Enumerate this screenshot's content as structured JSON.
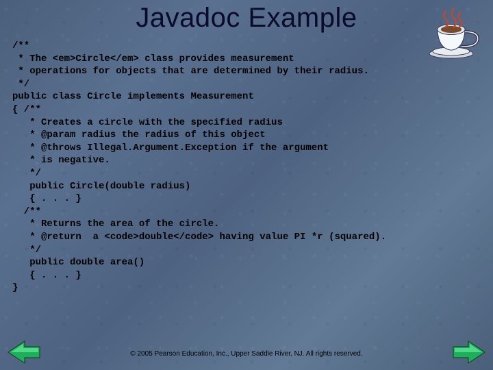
{
  "title": "Javadoc Example",
  "code_lines": [
    "/**",
    " * The <em>Circle</em> class provides measurement",
    " * operations for objects that are determined by their radius.",
    " */",
    "public class Circle implements Measurement",
    "{ /**",
    "   * Creates a circle with the specified radius",
    "   * @param radius the radius of this object",
    "   * @throws Illegal.Argument.Exception if the argument",
    "   * is negative.",
    "   */",
    "   public Circle(double radius)",
    "   { . . . }",
    "  /**",
    "   * Returns the area of the circle.",
    "   * @return  a <code>double</code> having value PI *r (squared).",
    "   */",
    "   public double area()",
    "   { . . . }",
    "}"
  ],
  "footer": "© 2005 Pearson Education, Inc., Upper Saddle River, NJ.  All rights reserved.",
  "icons": {
    "coffee": "coffee-cup-icon",
    "prev": "arrow-left-icon",
    "next": "arrow-right-icon"
  }
}
